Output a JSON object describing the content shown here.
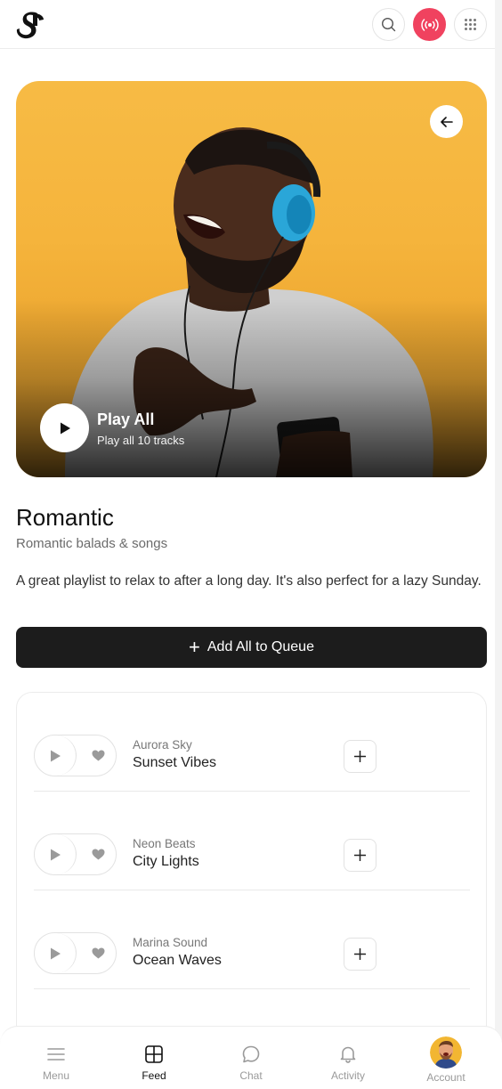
{
  "header": {
    "logo_icon": "music-logo-icon",
    "search_icon": "search-icon",
    "live_icon": "broadcast-icon",
    "apps_icon": "grid-dots-icon",
    "live_color": "#f0425f"
  },
  "hero": {
    "back_icon": "arrow-left-icon",
    "play_icon": "play-icon",
    "play_all_label": "Play All",
    "play_all_sub": "Play all 10 tracks",
    "background_color": "#f5b43c"
  },
  "playlist": {
    "title": "Romantic",
    "subtitle": "Romantic balads & songs",
    "description": "A great playlist to relax to after a long day. It's also perfect for a lazy Sunday.",
    "queue_label": "Add All to Queue",
    "queue_icon": "plus-icon"
  },
  "tracks": [
    {
      "artist": "Aurora Sky",
      "title": "Sunset Vibes"
    },
    {
      "artist": "Neon Beats",
      "title": "City Lights"
    },
    {
      "artist": "Marina Sound",
      "title": "Ocean Waves"
    }
  ],
  "bottom_nav": [
    {
      "label": "Menu",
      "icon": "menu-icon",
      "active": false
    },
    {
      "label": "Feed",
      "icon": "grid-square-icon",
      "active": true
    },
    {
      "label": "Chat",
      "icon": "chat-bubble-icon",
      "active": false
    },
    {
      "label": "Activity",
      "icon": "bell-icon",
      "active": false
    },
    {
      "label": "Account",
      "icon": "avatar",
      "active": false
    }
  ]
}
